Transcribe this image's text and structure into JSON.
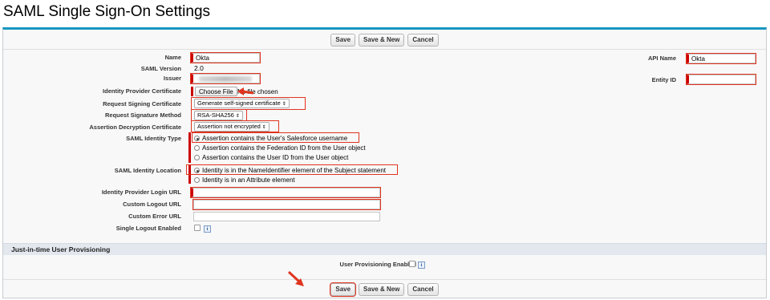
{
  "page": {
    "title": "SAML Single Sign-On Settings"
  },
  "buttons": {
    "save": "Save",
    "save_new": "Save & New",
    "cancel": "Cancel"
  },
  "fields": {
    "name": {
      "label": "Name",
      "value": "Okta"
    },
    "saml_version": {
      "label": "SAML Version",
      "value": "2.0"
    },
    "issuer": {
      "label": "Issuer",
      "value": ""
    },
    "idp_certificate": {
      "label": "Identity Provider Certificate",
      "button": "Choose File",
      "status": "No file chosen"
    },
    "request_signing_cert": {
      "label": "Request Signing Certificate",
      "value": "Generate self-signed certificate"
    },
    "request_signature_method": {
      "label": "Request Signature Method",
      "value": "RSA-SHA256"
    },
    "assertion_decryption_cert": {
      "label": "Assertion Decryption Certificate",
      "value": "Assertion not encrypted"
    },
    "saml_identity_type": {
      "label": "SAML Identity Type",
      "options": [
        "Assertion contains the User's Salesforce username",
        "Assertion contains the Federation ID from the User object",
        "Assertion contains the User ID from the User object"
      ],
      "selected": 0
    },
    "saml_identity_location": {
      "label": "SAML Identity Location",
      "options": [
        "Identity is in the NameIdentifier element of the Subject statement",
        "Identity is in an Attribute element"
      ],
      "selected": 0
    },
    "idp_login_url": {
      "label": "Identity Provider Login URL",
      "value": ""
    },
    "custom_logout_url": {
      "label": "Custom Logout URL",
      "value": ""
    },
    "custom_error_url": {
      "label": "Custom Error URL",
      "value": ""
    },
    "single_logout_enabled": {
      "label": "Single Logout Enabled"
    },
    "api_name": {
      "label": "API Name",
      "value": "Okta"
    },
    "entity_id": {
      "label": "Entity ID",
      "value": ""
    }
  },
  "jit": {
    "heading": "Just-in-time User Provisioning",
    "user_provisioning_label": "User Provisioning Enabled"
  },
  "colors": {
    "highlight": "#e0341e",
    "required": "#cc0000",
    "accent": "#1797c0"
  },
  "icons": {
    "info": "i"
  }
}
